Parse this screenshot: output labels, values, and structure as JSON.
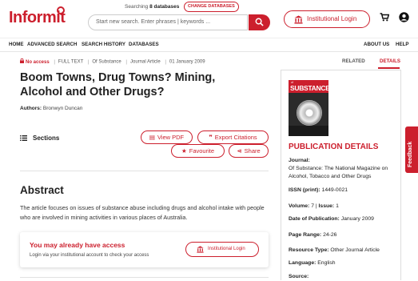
{
  "header": {
    "logo_part1": "Infor",
    "logo_part2": "mit",
    "searching_prefix": "Searching",
    "databases_count": "8 databases",
    "change_databases": "CHANGE DATABASES",
    "search_placeholder": "Start new search. Enter phrases | keywords ...",
    "institutional_login": "Institutional Login"
  },
  "nav": {
    "home": "HOME",
    "advanced_search": "ADVANCED SEARCH",
    "search_history": "SEARCH HISTORY",
    "databases": "DATABASES",
    "about_us": "ABOUT US",
    "help": "HELP"
  },
  "article": {
    "access": "No access",
    "full_text": "FULL TEXT",
    "source": "Of Substance",
    "type": "Journal Article",
    "date": "01 January 2009",
    "title": "Boom Towns, Drug Towns? Mining, Alcohol and Other Drugs?",
    "authors_label": "Authors:",
    "authors": "Bronwyn Duncan"
  },
  "actions": {
    "sections": "Sections",
    "view_pdf": "View PDF",
    "export_citations": "Export Citations",
    "favourite": "Favourite",
    "share": "Share"
  },
  "abstract": {
    "heading": "Abstract",
    "text": "The article focuses on issues of substance abuse including drugs and alcohol intake with people who are involved in mining activities in various places of Australia."
  },
  "access_box": {
    "heading": "You may already have access",
    "subtext": "Login via your institutional account to check your access",
    "button": "Institutional Login"
  },
  "panel": {
    "tab_related": "RELATED",
    "tab_details": "DETAILS",
    "cover_of": "of",
    "cover_title": "SUBSTANCE",
    "heading": "PUBLICATION DETAILS",
    "journal_label": "Journal:",
    "journal_value": "Of Substance: The National Magazine on Alcohol, Tobacco and Other Drugs",
    "issn_label": "ISSN (print):",
    "issn_value": "1449-0021",
    "volume_label": "Volume:",
    "volume_value": "7",
    "issue_label": "Issue:",
    "issue_value": "1",
    "date_label": "Date of Publication:",
    "date_value": "January 2009",
    "page_range_label": "Page Range:",
    "page_range_value": "24-26",
    "resource_type_label": "Resource Type:",
    "resource_type_value": "Other Journal Article",
    "language_label": "Language:",
    "language_value": "English",
    "source_label": "Source:"
  },
  "feedback": "Feedback",
  "colors": {
    "accent": "#cc1f2d"
  },
  "icons": [
    "search-icon",
    "institution-icon",
    "cart-icon",
    "user-icon",
    "lock-icon",
    "list-icon",
    "pdf-icon",
    "quote-icon",
    "star-icon",
    "share-icon"
  ]
}
